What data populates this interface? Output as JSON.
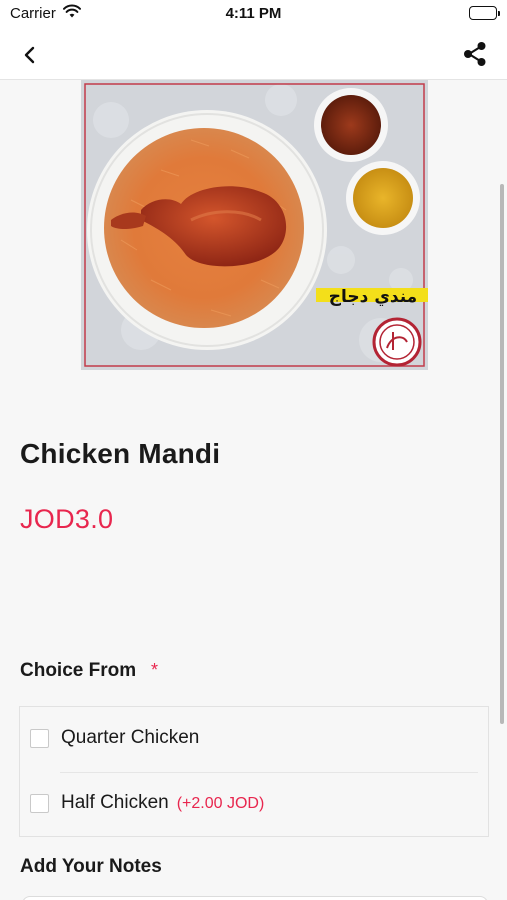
{
  "status_bar": {
    "carrier": "Carrier",
    "time": "4:11 PM"
  },
  "nav": {
    "back_icon": "chevron-left-icon",
    "share_icon": "share-icon"
  },
  "product": {
    "image_caption": "مندي دجاج",
    "name": "Chicken Mandi",
    "price": "JOD3.0"
  },
  "choice": {
    "heading": "Choice From",
    "required_marker": "*",
    "options": [
      {
        "label": "Quarter Chicken",
        "extra": "",
        "checked": false
      },
      {
        "label": "Half Chicken",
        "extra": "(+2.00 JOD)",
        "checked": false
      }
    ]
  },
  "notes": {
    "heading": "Add Your Notes",
    "placeholder": ""
  },
  "colors": {
    "accent": "#e8264e",
    "background": "#f7f7f7"
  }
}
